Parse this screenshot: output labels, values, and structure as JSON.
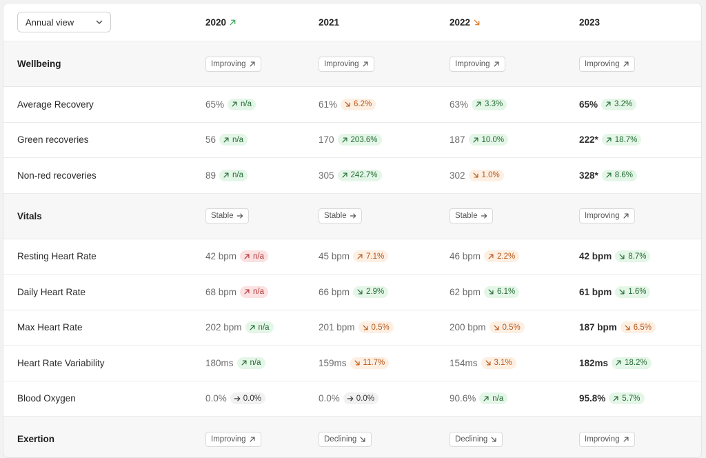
{
  "view_select": {
    "label": "Annual view"
  },
  "years": [
    {
      "label": "2020",
      "trend": "up",
      "color": "#3aa860"
    },
    {
      "label": "2021",
      "trend": "none",
      "color": "#222222"
    },
    {
      "label": "2022",
      "trend": "down",
      "color": "#e0761f"
    },
    {
      "label": "2023",
      "trend": "none",
      "color": "#222222"
    }
  ],
  "colors": {
    "green_text": "#256b35",
    "green_bg": "#e4f6e7",
    "orange_text": "#b6561b",
    "orange_bg": "#fdefe2",
    "red_text": "#b13535",
    "red_bg": "#fbe1e1",
    "neutral_text": "#333333",
    "neutral_bg": "#f1f1f1"
  },
  "sections": [
    {
      "title": "Wellbeing",
      "statuses": [
        {
          "label": "Improving",
          "icon": "arrow-up-right-icon"
        },
        {
          "label": "Improving",
          "icon": "arrow-up-right-icon"
        },
        {
          "label": "Improving",
          "icon": "arrow-up-right-icon"
        },
        {
          "label": "Improving",
          "icon": "arrow-up-right-icon"
        }
      ],
      "rows": [
        {
          "name": "Average Recovery",
          "cells": [
            {
              "value": "65%",
              "change": "n/a",
              "dir": "up",
              "tone": "g"
            },
            {
              "value": "61%",
              "change": "6.2%",
              "dir": "down",
              "tone": "o"
            },
            {
              "value": "63%",
              "change": "3.3%",
              "dir": "up",
              "tone": "g"
            },
            {
              "value": "65%",
              "change": "3.2%",
              "dir": "up",
              "tone": "g",
              "bold": true
            }
          ]
        },
        {
          "name": "Green recoveries",
          "cells": [
            {
              "value": "56",
              "change": "n/a",
              "dir": "up",
              "tone": "g"
            },
            {
              "value": "170",
              "change": "203.6%",
              "dir": "up",
              "tone": "g"
            },
            {
              "value": "187",
              "change": "10.0%",
              "dir": "up",
              "tone": "g"
            },
            {
              "value": "222*",
              "change": "18.7%",
              "dir": "up",
              "tone": "g",
              "bold": true
            }
          ]
        },
        {
          "name": "Non-red recoveries",
          "cells": [
            {
              "value": "89",
              "change": "n/a",
              "dir": "up",
              "tone": "g"
            },
            {
              "value": "305",
              "change": "242.7%",
              "dir": "up",
              "tone": "g"
            },
            {
              "value": "302",
              "change": "1.0%",
              "dir": "down",
              "tone": "o"
            },
            {
              "value": "328*",
              "change": "8.6%",
              "dir": "up",
              "tone": "g",
              "bold": true
            }
          ]
        }
      ]
    },
    {
      "title": "Vitals",
      "statuses": [
        {
          "label": "Stable",
          "icon": "arrow-right-icon"
        },
        {
          "label": "Stable",
          "icon": "arrow-right-icon"
        },
        {
          "label": "Stable",
          "icon": "arrow-right-icon"
        },
        {
          "label": "Improving",
          "icon": "arrow-up-right-icon"
        }
      ],
      "rows": [
        {
          "name": "Resting Heart Rate",
          "cells": [
            {
              "value": "42 bpm",
              "change": "n/a",
              "dir": "up",
              "tone": "r"
            },
            {
              "value": "45 bpm",
              "change": "7.1%",
              "dir": "up",
              "tone": "o"
            },
            {
              "value": "46 bpm",
              "change": "2.2%",
              "dir": "up",
              "tone": "o"
            },
            {
              "value": "42 bpm",
              "change": "8.7%",
              "dir": "down",
              "tone": "g",
              "bold": true
            }
          ]
        },
        {
          "name": "Daily Heart Rate",
          "cells": [
            {
              "value": "68 bpm",
              "change": "n/a",
              "dir": "up",
              "tone": "r"
            },
            {
              "value": "66 bpm",
              "change": "2.9%",
              "dir": "down",
              "tone": "g"
            },
            {
              "value": "62 bpm",
              "change": "6.1%",
              "dir": "down",
              "tone": "g"
            },
            {
              "value": "61 bpm",
              "change": "1.6%",
              "dir": "down",
              "tone": "g",
              "bold": true
            }
          ]
        },
        {
          "name": "Max Heart Rate",
          "cells": [
            {
              "value": "202 bpm",
              "change": "n/a",
              "dir": "up",
              "tone": "g"
            },
            {
              "value": "201 bpm",
              "change": "0.5%",
              "dir": "down",
              "tone": "o"
            },
            {
              "value": "200 bpm",
              "change": "0.5%",
              "dir": "down",
              "tone": "o"
            },
            {
              "value": "187 bpm",
              "change": "6.5%",
              "dir": "down",
              "tone": "o",
              "bold": true
            }
          ]
        },
        {
          "name": "Heart Rate Variability",
          "cells": [
            {
              "value": "180ms",
              "change": "n/a",
              "dir": "up",
              "tone": "g"
            },
            {
              "value": "159ms",
              "change": "11.7%",
              "dir": "down",
              "tone": "o"
            },
            {
              "value": "154ms",
              "change": "3.1%",
              "dir": "down",
              "tone": "o"
            },
            {
              "value": "182ms",
              "change": "18.2%",
              "dir": "up",
              "tone": "g",
              "bold": true
            }
          ]
        },
        {
          "name": "Blood Oxygen",
          "cells": [
            {
              "value": "0.0%",
              "change": "0.0%",
              "dir": "flat",
              "tone": "n"
            },
            {
              "value": "0.0%",
              "change": "0.0%",
              "dir": "flat",
              "tone": "n"
            },
            {
              "value": "90.6%",
              "change": "n/a",
              "dir": "up",
              "tone": "g"
            },
            {
              "value": "95.8%",
              "change": "5.7%",
              "dir": "up",
              "tone": "g",
              "bold": true
            }
          ]
        }
      ]
    },
    {
      "title": "Exertion",
      "statuses": [
        {
          "label": "Improving",
          "icon": "arrow-up-right-icon"
        },
        {
          "label": "Declining",
          "icon": "arrow-down-right-icon"
        },
        {
          "label": "Declining",
          "icon": "arrow-down-right-icon"
        },
        {
          "label": "Improving",
          "icon": "arrow-up-right-icon"
        }
      ],
      "rows": []
    }
  ]
}
